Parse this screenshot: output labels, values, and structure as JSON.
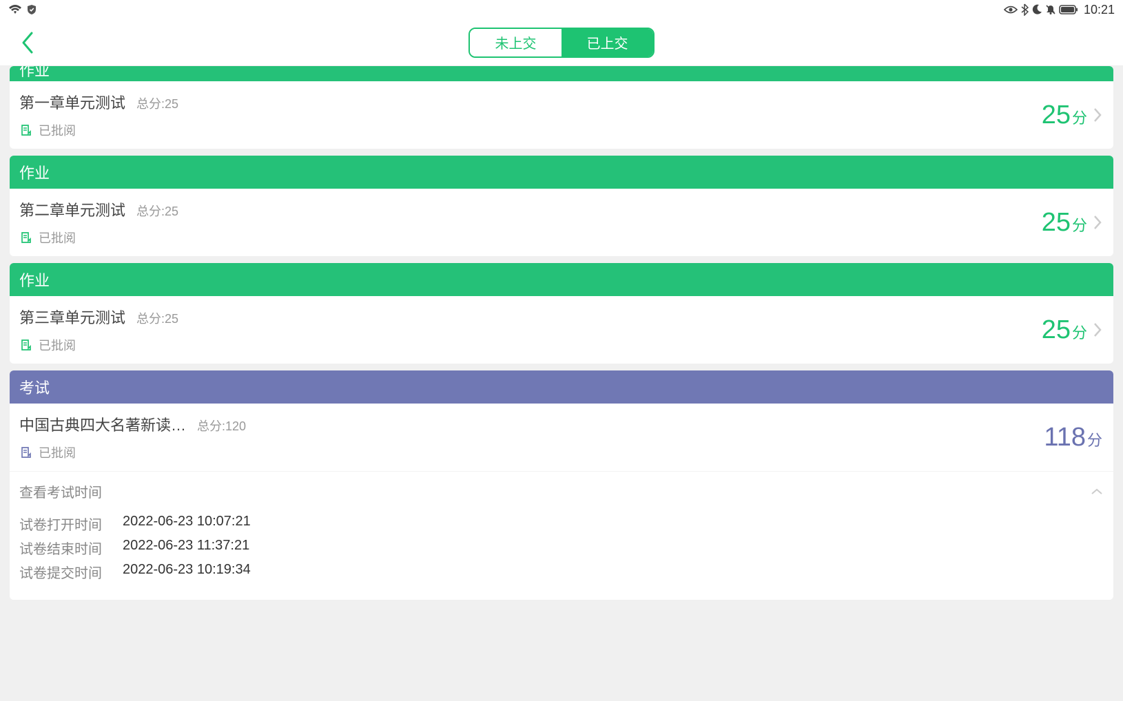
{
  "status_bar": {
    "time": "10:21"
  },
  "nav": {
    "tab_unsubmitted": "未上交",
    "tab_submitted": "已上交"
  },
  "categories": {
    "homework": "作业",
    "exam": "考试"
  },
  "items": [
    {
      "category": "homework",
      "title": "第一章单元测试",
      "total_label": "总分:25",
      "status": "已批阅",
      "score": "25",
      "score_unit": "分",
      "partial_header": true
    },
    {
      "category": "homework",
      "title": "第二章单元测试",
      "total_label": "总分:25",
      "status": "已批阅",
      "score": "25",
      "score_unit": "分"
    },
    {
      "category": "homework",
      "title": "第三章单元测试",
      "total_label": "总分:25",
      "status": "已批阅",
      "score": "25",
      "score_unit": "分"
    },
    {
      "category": "exam",
      "title": "中国古典四大名著新读…",
      "total_label": "总分:120",
      "status": "已批阅",
      "score": "118",
      "score_unit": "分"
    }
  ],
  "exam_detail": {
    "header": "查看考试时间",
    "rows": [
      {
        "label": "试卷打开时间",
        "value": "2022-06-23 10:07:21"
      },
      {
        "label": "试卷结束时间",
        "value": "2022-06-23 11:37:21"
      },
      {
        "label": "试卷提交时间",
        "value": "2022-06-23 10:19:34"
      }
    ]
  }
}
